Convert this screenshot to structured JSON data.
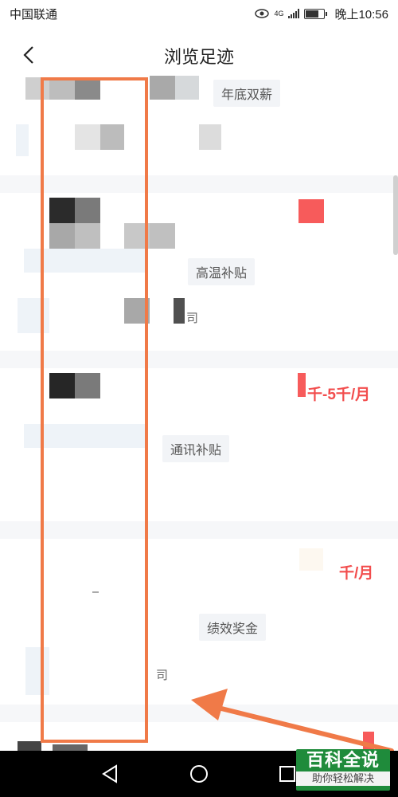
{
  "status_bar": {
    "carrier": "中国联通",
    "network": "4G",
    "time": "晚上10:56"
  },
  "header": {
    "title": "浏览足迹"
  },
  "list": {
    "tags": [
      "年底双薪",
      "高温补贴",
      "通讯补贴",
      "绩效奖金"
    ],
    "snippets": [
      "司",
      "司",
      "司"
    ],
    "salaries": [
      "千-5千/月",
      "千/月"
    ]
  },
  "watermark": {
    "main": "百科全说",
    "sub": "助你轻松解决"
  },
  "icons": {
    "back": "back-arrow-icon",
    "eye": "eye-icon",
    "signal": "signal-icon",
    "battery": "battery-icon",
    "nav_back": "nav-back-icon",
    "nav_home": "nav-home-icon",
    "nav_recent": "nav-recent-icon"
  },
  "colors": {
    "annotation": "#f07a48",
    "salary": "#f24d4d",
    "watermark": "#1f8b3b"
  }
}
